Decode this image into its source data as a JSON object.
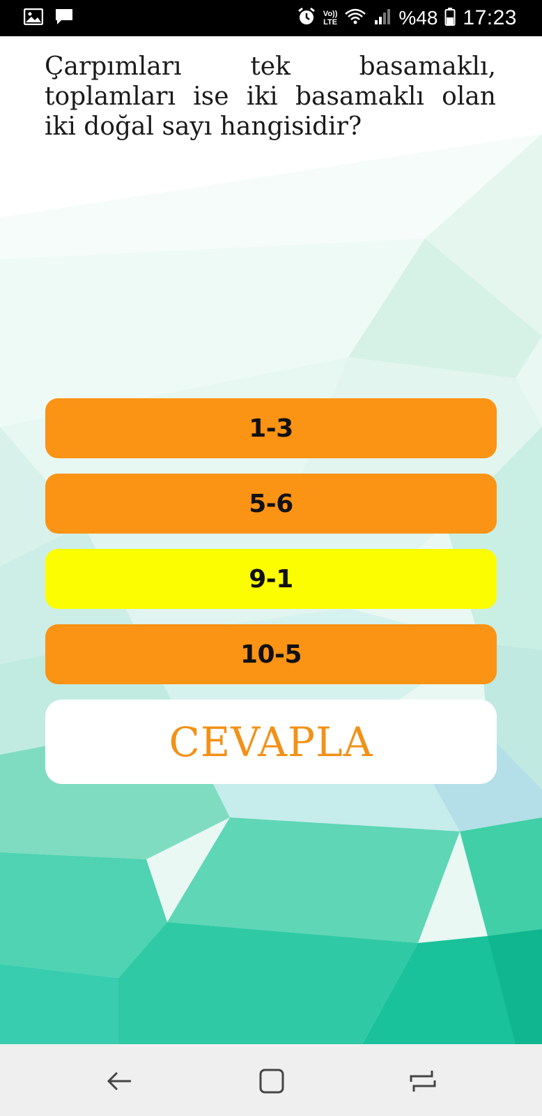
{
  "status_bar": {
    "icons_left": [
      "image-icon",
      "message-icon"
    ],
    "icons_right": [
      "alarm-icon",
      "volte-icon",
      "wifi-icon",
      "signal-icon"
    ],
    "volte_label": "Vo))",
    "lte_label": "LTE",
    "battery": "%48",
    "time": "17:23"
  },
  "question": {
    "text": "Çarpımları tek basamaklı, toplamları ise iki basamaklı olan iki doğal sayı hangisidir?"
  },
  "options": [
    {
      "label": "1-3",
      "selected": false
    },
    {
      "label": "5-6",
      "selected": false
    },
    {
      "label": "9-1",
      "selected": true
    },
    {
      "label": "10-5",
      "selected": false
    }
  ],
  "answer_button": {
    "label": "CEVAPLA"
  },
  "colors": {
    "option": "#fb9314",
    "option_selected": "#fcfd00",
    "answer_text": "#f29117",
    "teal": "#1ec9a4"
  },
  "nav_bar": {
    "buttons": [
      "back-icon",
      "home-icon",
      "recents-icon"
    ]
  }
}
